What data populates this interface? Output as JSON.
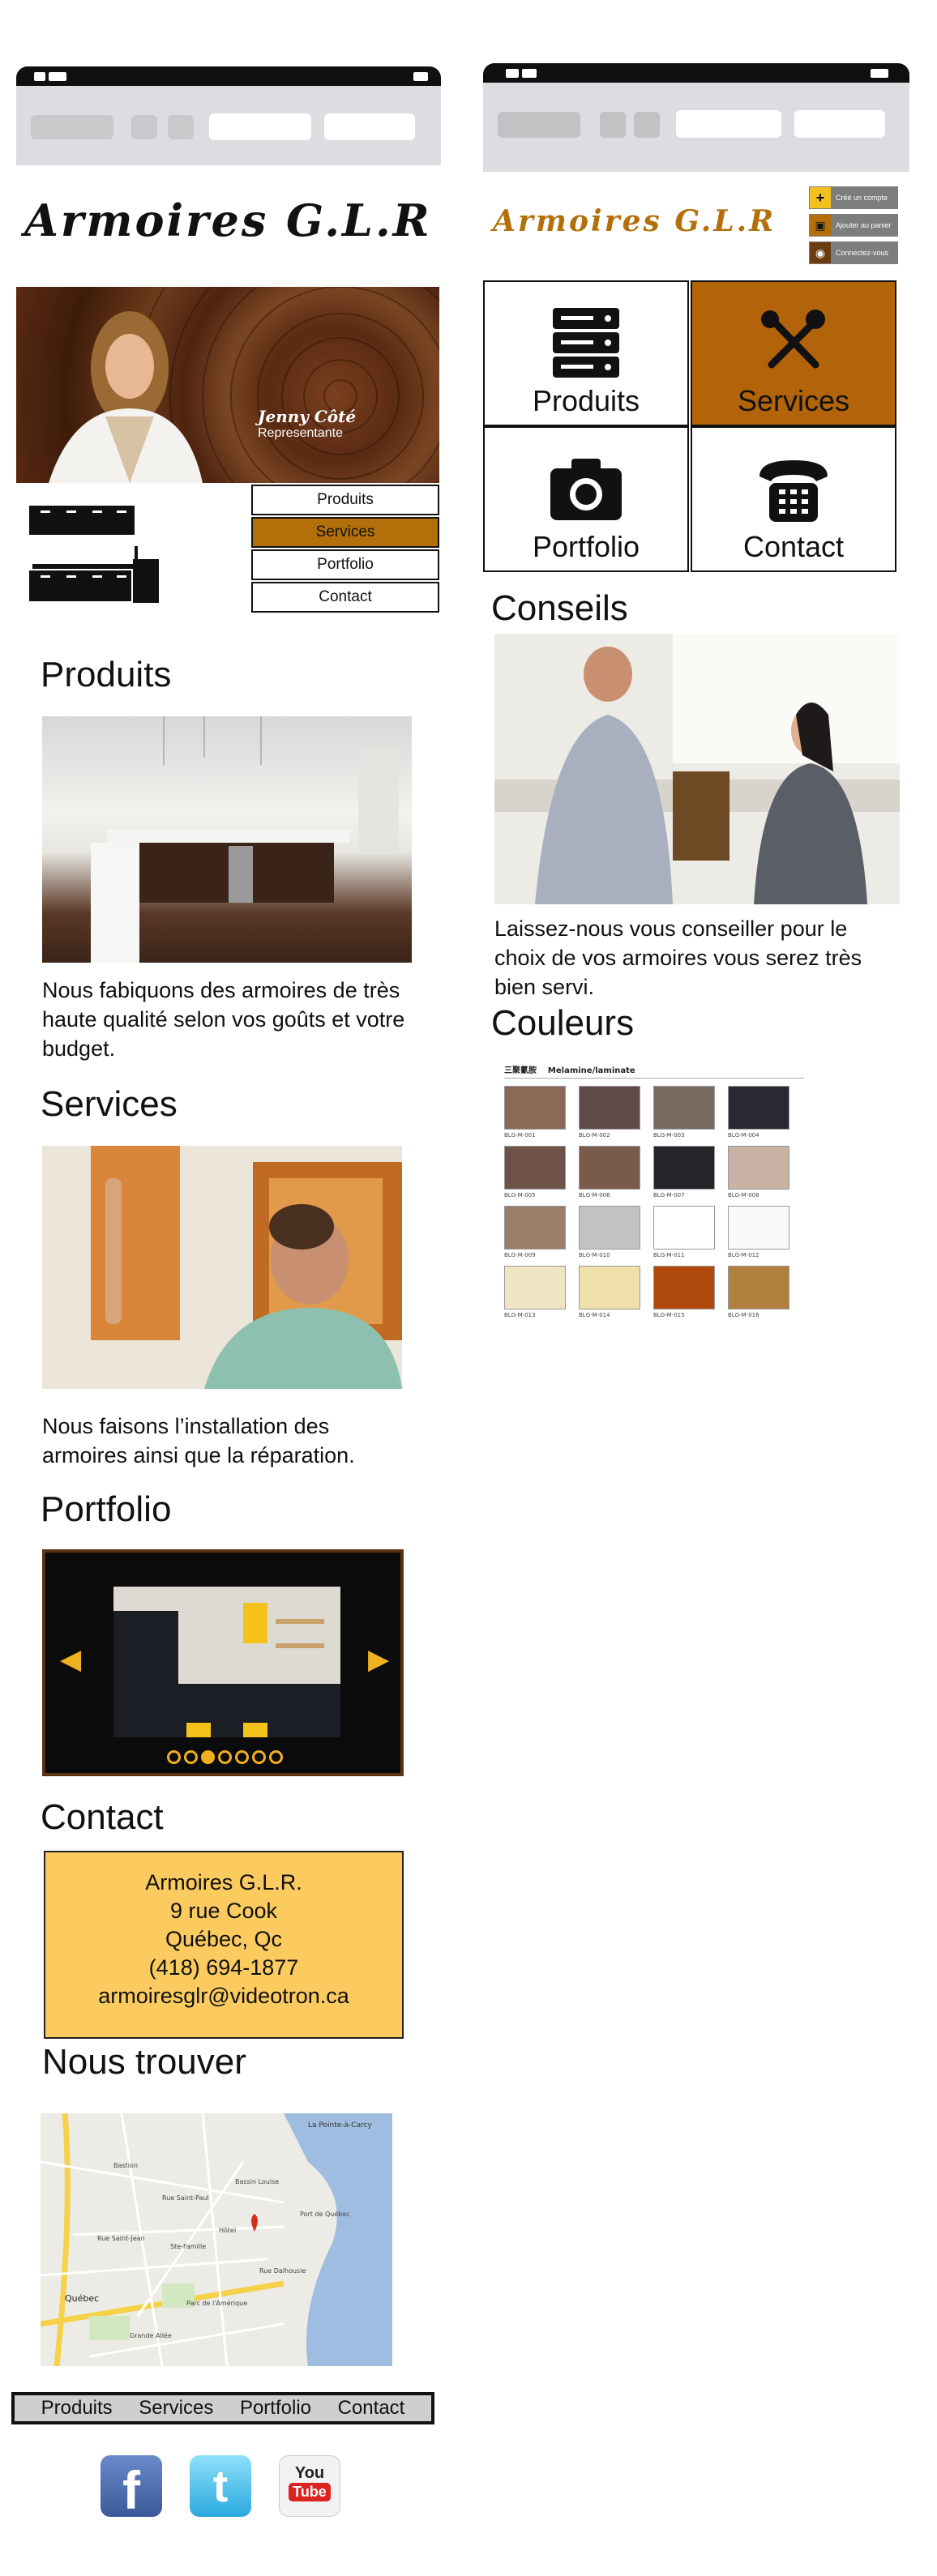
{
  "mobile": {
    "brand": "Armoires G.L.R",
    "hero": {
      "name": "Jenny Côté",
      "role": "Representante"
    },
    "nav": [
      "Produits",
      "Services",
      "Portfolio",
      "Contact"
    ],
    "active_nav": "Services",
    "sections": {
      "produits": {
        "title": "Produits",
        "text": "Nous fabiquons des armoires de très haute qualité selon vos goûts et votre budget."
      },
      "services": {
        "title": "Services",
        "text": "Nous faisons l’installation des armoires ainsi que la réparation."
      },
      "portfolio": {
        "title": "Portfolio"
      },
      "contact": {
        "title": "Contact",
        "lines": [
          "Armoires G.L.R.",
          "9 rue Cook",
          "Québec, Qc",
          "(418) 694-1877",
          "armoiresglr@videotron.ca"
        ]
      },
      "map": {
        "title": "Nous trouver",
        "labels": [
          "La Pointe-à-Carcy",
          "Québec",
          "Bassin Louise",
          "Rue Saint-Paul",
          "Rue Dalhousie",
          "Port de Québec",
          "Rue Saint-Jean",
          "Grande Allée",
          "Ste-Famille",
          "Parc de l'Amérique",
          "Bastion",
          "Hôtel"
        ]
      },
      "footer_nav": [
        "Produits",
        "Services",
        "Portfolio",
        "Contact"
      ],
      "social": [
        "facebook-icon",
        "twitter-icon",
        "youtube-icon"
      ]
    },
    "carousel": {
      "dots": 7,
      "active_dot": 3,
      "prev": "◀",
      "next": "▶"
    }
  },
  "desktop": {
    "brand": "Armoires G.L.R",
    "account_buttons": [
      {
        "label": "Créé un compte",
        "icon": "plus-icon"
      },
      {
        "label": "Ajouter au panier",
        "icon": "cart-icon"
      },
      {
        "label": "Connectez-vous",
        "icon": "login-icon"
      }
    ],
    "tiles": [
      {
        "label": "Produits",
        "icon": "server-icon"
      },
      {
        "label": "Services",
        "icon": "tools-icon"
      },
      {
        "label": "Portfolio",
        "icon": "camera-icon"
      },
      {
        "label": "Contact",
        "icon": "phone-icon"
      }
    ],
    "active_tile": "Services",
    "conseils": {
      "title": "Conseils",
      "text": "Laissez-nous vous conseiller pour le choix de vos armoires vous serez très bien servi."
    },
    "couleurs": {
      "title": "Couleurs",
      "chart_header": "三聚氰胺    Melamine/laminate",
      "swatches": [
        {
          "code": "BLG-M-001",
          "color": "#8a6a56"
        },
        {
          "code": "BLG-M-002",
          "color": "#5e4a46"
        },
        {
          "code": "BLG-M-003",
          "color": "#7a6a62"
        },
        {
          "code": "BLG-M-004",
          "color": "#2a2830"
        },
        {
          "code": "BLG-M-005",
          "color": "#6e5248"
        },
        {
          "code": "BLG-M-006",
          "color": "#7a5a4a"
        },
        {
          "code": "BLG-M-007",
          "color": "#26262a"
        },
        {
          "code": "BLG-M-008",
          "color": "#c8b2a4"
        },
        {
          "code": "BLG-M-009",
          "color": "#9a7e68"
        },
        {
          "code": "BLG-M-010",
          "color": "#c2c2c2"
        },
        {
          "code": "BLG-M-011",
          "color": "#ffffff"
        },
        {
          "code": "BLG-M-012",
          "color": "#fafafa"
        },
        {
          "code": "BLG-M-013",
          "color": "#f0e4c4"
        },
        {
          "code": "BLG-M-014",
          "color": "#efdfaa"
        },
        {
          "code": "BLG-M-015",
          "color": "#b04a0c"
        },
        {
          "code": "BLG-M-016",
          "color": "#b0803e"
        }
      ]
    }
  },
  "colors": {
    "accent": "#b3700a",
    "contact_bg": "#fbcb60",
    "carousel_bg": "#0b0b0b"
  }
}
